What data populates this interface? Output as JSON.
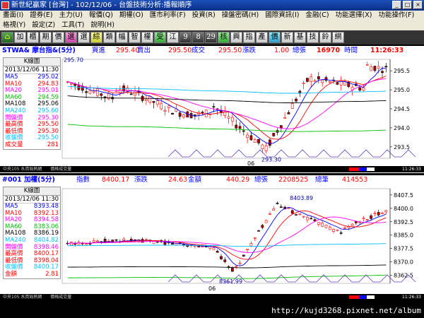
{
  "window": {
    "title": "新世紀贏家 [台灣] - 102/12/06 - 台盤技術分析:播報順序"
  },
  "menu": {
    "row1": [
      "畫面(I)",
      "證券(E)",
      "主力(U)",
      "報價(Q)",
      "期權(O)",
      "匯市利率(F)",
      "投資(R)",
      "操盤密碼(H)",
      "國際資訊(I)",
      "金融(C)",
      "功能選擇(X)",
      "功能操作(F)"
    ],
    "row2": [
      "格視(Y)",
      "設定(Z)",
      "工具(T)",
      "說明(H)"
    ]
  },
  "toolbar": [
    "加",
    "櫃",
    "期",
    "價",
    "選",
    "選",
    "綜",
    "類",
    "幅",
    "智",
    "權",
    "受",
    "江",
    "9",
    "8",
    "29",
    "核",
    "興",
    "指",
    "產",
    "價",
    "新",
    "基",
    "技",
    "鈴",
    "網"
  ],
  "top_panel": {
    "symbol": "STWA& 摩台指&(5分)",
    "buy_label": "買進",
    "buy": "295.40",
    "sell_label": "賣出",
    "sell": "295.50",
    "deal_label": "成交",
    "deal": "295.50",
    "chg_label": "漲跌",
    "chg": "1.00",
    "vol_label": "總張",
    "vol": "16970",
    "time_label": "時間",
    "time": "11:26:33",
    "legend_title": "K線圖",
    "legend_date": "2013/12/06 11:30",
    "legend": [
      {
        "k": "MA5",
        "v": "295.02",
        "c": "#0000ff"
      },
      {
        "k": "MA10",
        "v": "294.83",
        "c": "#ff0000"
      },
      {
        "k": "MA20",
        "v": "295.01",
        "c": "#ff00ff"
      },
      {
        "k": "MA60",
        "v": "294.59",
        "c": "#00c000"
      },
      {
        "k": "MA108",
        "v": "295.06",
        "c": "#000000"
      },
      {
        "k": "MA240",
        "v": "295.60",
        "c": "#00c0ff"
      },
      {
        "k": "開盤價",
        "v": "295.30",
        "c": "#ff00ff"
      },
      {
        "k": "最高價",
        "v": "295.50",
        "c": "#ff0000"
      },
      {
        "k": "最低價",
        "v": "295.30",
        "c": "#ff0000"
      },
      {
        "k": "收盤價",
        "v": "295.50",
        "c": "#00c0ff"
      },
      {
        "k": "成交量",
        "v": "281",
        "c": "#ff0000"
      }
    ],
    "y_ticks": [
      "295.5",
      "295.0",
      "294.5",
      "294.0",
      "293.5"
    ],
    "hi_label": "295.70",
    "lo_label": "293.30",
    "x_label": "06",
    "status_left": "中央105 水資局熱網",
    "status_mid": "價格成交量",
    "status_right": "11:26:33",
    "chart_data": {
      "type": "candlestick",
      "ylim": [
        293.2,
        295.8
      ],
      "y_ticks": [
        295.5,
        295.0,
        294.5,
        294.0,
        293.5
      ],
      "x_tick_labels": [
        "06"
      ],
      "annotations": [
        "295.70",
        "293.30"
      ]
    }
  },
  "bottom_panel": {
    "symbol": "#001 加權(5分)",
    "idx_label": "指數",
    "idx": "8400.17",
    "chg_label": "漲跌",
    "chg": "24.63",
    "amt_label": "金額",
    "amt": "440.29",
    "vol_label": "總張",
    "vol": "2208525",
    "cnt_label": "總筆",
    "cnt": "414553",
    "legend_title": "K線圖",
    "legend_date": "2013/12/06 11:30",
    "legend": [
      {
        "k": "MA5",
        "v": "8393.48",
        "c": "#0000ff"
      },
      {
        "k": "MA10",
        "v": "8392.13",
        "c": "#ff0000"
      },
      {
        "k": "MA20",
        "v": "8394.58",
        "c": "#ff00ff"
      },
      {
        "k": "MA60",
        "v": "8383.06",
        "c": "#00c000"
      },
      {
        "k": "MA108",
        "v": "8386.19",
        "c": "#000000"
      },
      {
        "k": "MA240",
        "v": "8404.82",
        "c": "#00c0ff"
      },
      {
        "k": "開盤價",
        "v": "8398.46",
        "c": "#ff00ff"
      },
      {
        "k": "最高價",
        "v": "8400.17",
        "c": "#ff0000"
      },
      {
        "k": "最低價",
        "v": "8398.04",
        "c": "#ff0000"
      },
      {
        "k": "收盤價",
        "v": "8400.17",
        "c": "#00c0ff"
      },
      {
        "k": "金額",
        "v": "2.81",
        "c": "#ff0000"
      }
    ],
    "y_ticks": [
      "8407.5",
      "8400.0",
      "8392.5",
      "8385.0",
      "8377.5",
      "8370.0",
      "8362.5"
    ],
    "hi_label": "8403.89",
    "lo_label": "8361.99",
    "x_label": "06",
    "status_left": "中央105 水資局熱網",
    "status_mid": "價格成交量",
    "status_right": "11:26:33",
    "chart_data": {
      "type": "candlestick",
      "ylim": [
        8358,
        8411
      ],
      "y_ticks": [
        8407.5,
        8400.0,
        8392.5,
        8385.0,
        8377.5,
        8370.0,
        8362.5
      ],
      "x_tick_labels": [
        "06"
      ],
      "annotations": [
        "8403.89",
        "8361.99"
      ]
    }
  },
  "watermark": "http://kujd3268.pixnet.net/album"
}
